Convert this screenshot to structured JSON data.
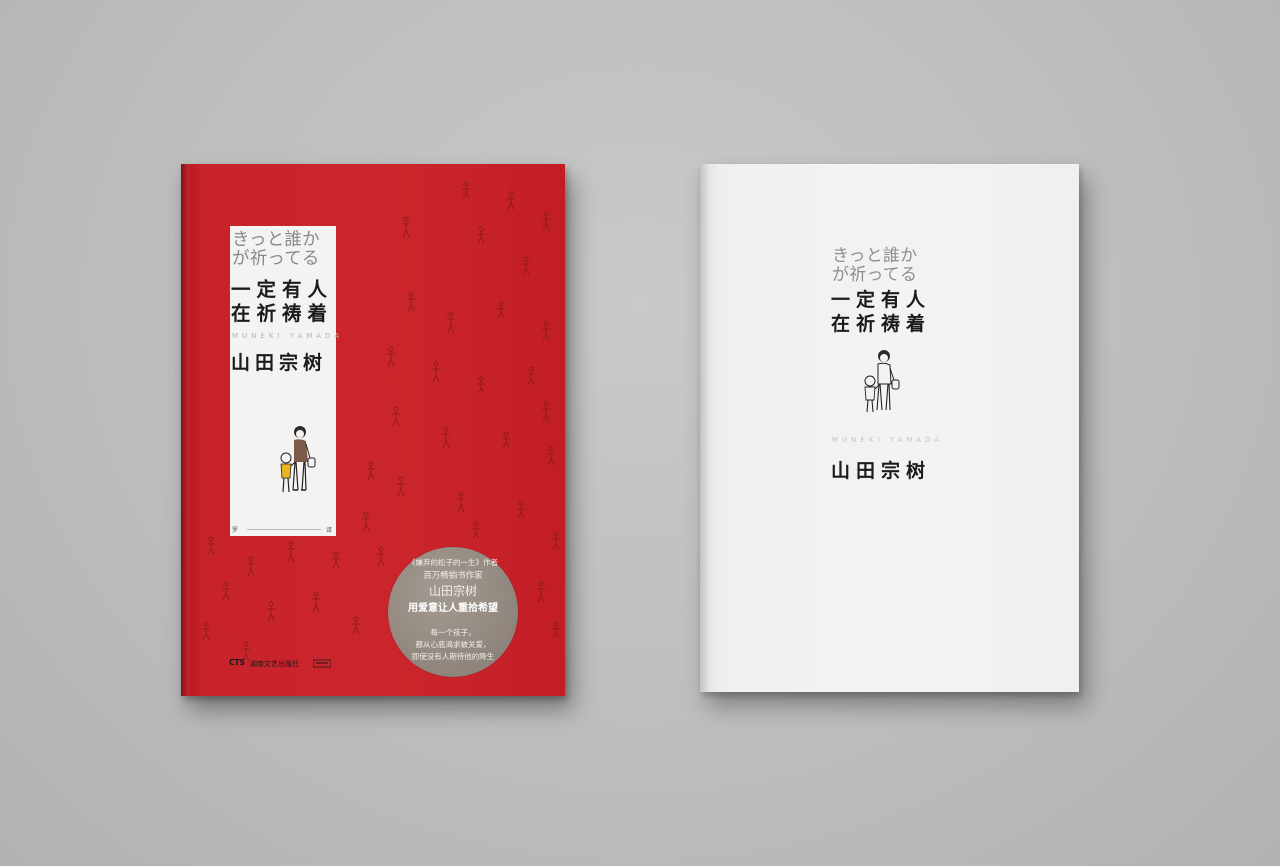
{
  "red_book": {
    "title_jp_line1": "きっと誰か",
    "title_jp_line2": "が祈ってる",
    "title_cn_line1": "一定有人",
    "title_cn_line2": "在祈祷着",
    "author_roman": "MUNEKI YAMADA",
    "author_cn": "山田宗树",
    "translator_left": "罗",
    "translator_right": "译",
    "sticker": {
      "line1": "《嫌弃的松子的一生》作者",
      "line2": "百万畅销书作家",
      "line3": "山田宗树",
      "line4": "用爱意让人重拾希望",
      "line5": "每一个孩子，",
      "line6": "都从心底渴求被关爱，",
      "line7": "即使没有人期待他的降生"
    },
    "publisher_logo": "CTS",
    "publisher_name": "湖南文艺出版社",
    "cover_color": "#cb252c"
  },
  "white_book": {
    "title_jp_line1": "きっと誰か",
    "title_jp_line2": "が祈ってる",
    "title_cn_line1": "一定有人",
    "title_cn_line2": "在祈祷着",
    "author_roman": "MUNEKI YAMADA",
    "author_cn": "山田宗树",
    "cover_color": "#f3f3f3"
  },
  "background_color": "#bdbdbd"
}
